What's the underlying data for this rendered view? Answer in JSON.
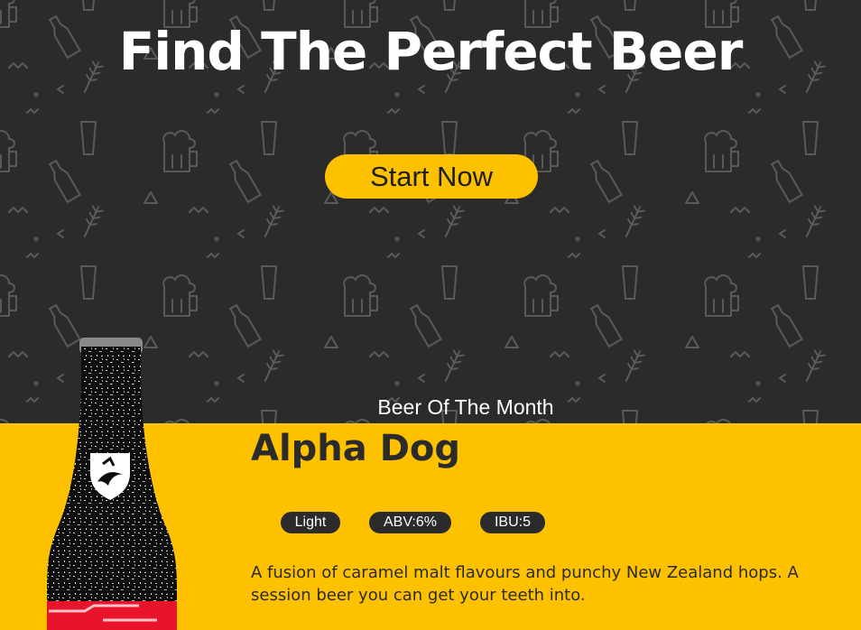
{
  "hero": {
    "title": "Find The Perfect Beer",
    "cta_label": "Start Now"
  },
  "beer_of_month": {
    "section_label": "Beer Of The Month",
    "name": "Alpha Dog",
    "tags": [
      "Light",
      "ABV:6%",
      "IBU:5"
    ],
    "description": "A fusion of caramel malt flavours and punchy New Zealand hops. A session beer you can get your teeth into."
  },
  "colors": {
    "hero_bg": "#2b2b2b",
    "accent": "#fdc100",
    "text_dark": "#2b2b2b",
    "text_light": "#ffffff"
  },
  "icons": {
    "pattern": [
      "beer-mug-icon",
      "bottle-icon",
      "pint-glass-icon",
      "wheat-icon",
      "triangle-icon"
    ],
    "bottle_logo": "dog-shield-logo"
  }
}
